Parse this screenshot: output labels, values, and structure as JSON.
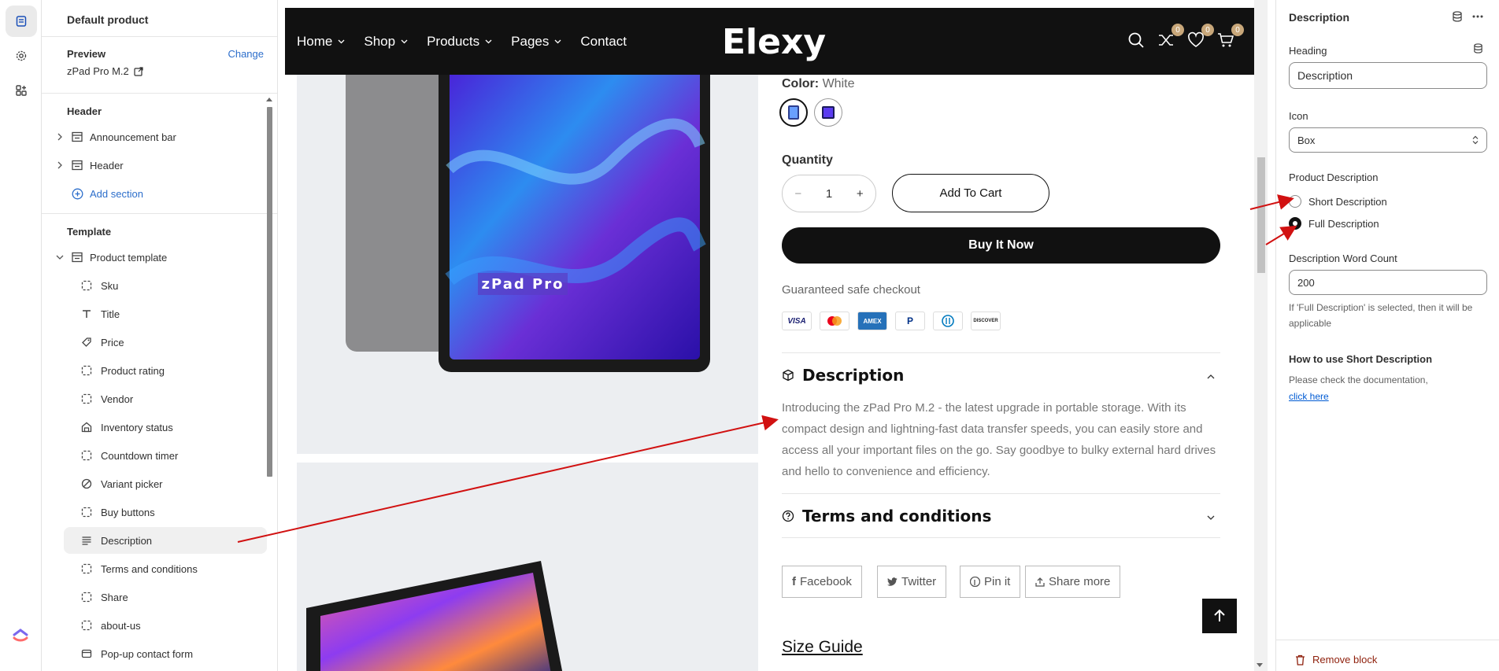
{
  "rail": {
    "icons": [
      "sections-icon",
      "settings-gear-icon",
      "apps-icon",
      "clickup-logo"
    ]
  },
  "sidebar": {
    "title": "Default product",
    "preview_label": "Preview",
    "change_label": "Change",
    "preview_value": "zPad Pro M.2",
    "header_group": "Header",
    "header_items": [
      {
        "label": "Announcement bar"
      },
      {
        "label": "Header"
      }
    ],
    "add_section": "Add section",
    "template_group": "Template",
    "product_template": "Product template",
    "blocks": [
      {
        "label": "Sku",
        "icon": "dashed-square-icon"
      },
      {
        "label": "Title",
        "icon": "title-t-icon"
      },
      {
        "label": "Price",
        "icon": "price-tag-icon"
      },
      {
        "label": "Product rating",
        "icon": "dashed-square-icon"
      },
      {
        "label": "Vendor",
        "icon": "dashed-square-icon"
      },
      {
        "label": "Inventory status",
        "icon": "inventory-icon"
      },
      {
        "label": "Countdown timer",
        "icon": "dashed-square-icon"
      },
      {
        "label": "Variant picker",
        "icon": "variant-icon"
      },
      {
        "label": "Buy buttons",
        "icon": "dashed-square-icon"
      },
      {
        "label": "Description",
        "icon": "text-lines-icon"
      },
      {
        "label": "Terms and conditions",
        "icon": "dashed-square-icon"
      },
      {
        "label": "Share",
        "icon": "dashed-square-icon"
      },
      {
        "label": "about-us",
        "icon": "dashed-square-icon"
      },
      {
        "label": "Pop-up contact form",
        "icon": "popup-icon"
      }
    ]
  },
  "store": {
    "nav": [
      "Home",
      "Shop",
      "Products",
      "Pages",
      "Contact"
    ],
    "logo": "Elexy",
    "badges": {
      "compare": "0",
      "wishlist": "0",
      "cart": "0"
    },
    "image_text": "zPad Pro",
    "color_label": "Color:",
    "color_value": "White",
    "quantity_label": "Quantity",
    "quantity_value": "1",
    "add_to_cart": "Add To Cart",
    "buy_now": "Buy It Now",
    "guarantee": "Guaranteed safe checkout",
    "payments": [
      "VISA",
      "MC",
      "AMEX",
      "PayPal",
      "Diners",
      "DISCOVER"
    ],
    "description_title": "Description",
    "description_text": "Introducing the zPad Pro M.2 - the latest upgrade in portable storage. With its compact design and lightning-fast data transfer speeds, you can easily store and access all your important files on the go. Say goodbye to bulky external hard drives and hello to convenience and efficiency.",
    "terms_title": "Terms and conditions",
    "share": {
      "facebook": "Facebook",
      "twitter": "Twitter",
      "pin": "Pin it",
      "more": "Share more"
    },
    "size_guide": "Size Guide"
  },
  "settings": {
    "title": "Description",
    "heading_label": "Heading",
    "heading_value": "Description",
    "icon_label": "Icon",
    "icon_value": "Box",
    "product_desc_label": "Product Description",
    "radio_short": "Short Description",
    "radio_full": "Full Description",
    "selected": "Full Description",
    "word_count_label": "Description Word Count",
    "word_count_value": "200",
    "help_text": "If 'Full Description' is selected, then it will be applicable",
    "howto_title": "How to use Short Description",
    "doc_text": "Please check the documentation,",
    "doc_link": "click here",
    "remove_block": "Remove block"
  },
  "colors": {
    "accent_link": "#2c6ecb",
    "badge": "#c8a77a",
    "annotation_arrow": "#d11111",
    "remove": "#8e1f0b"
  }
}
